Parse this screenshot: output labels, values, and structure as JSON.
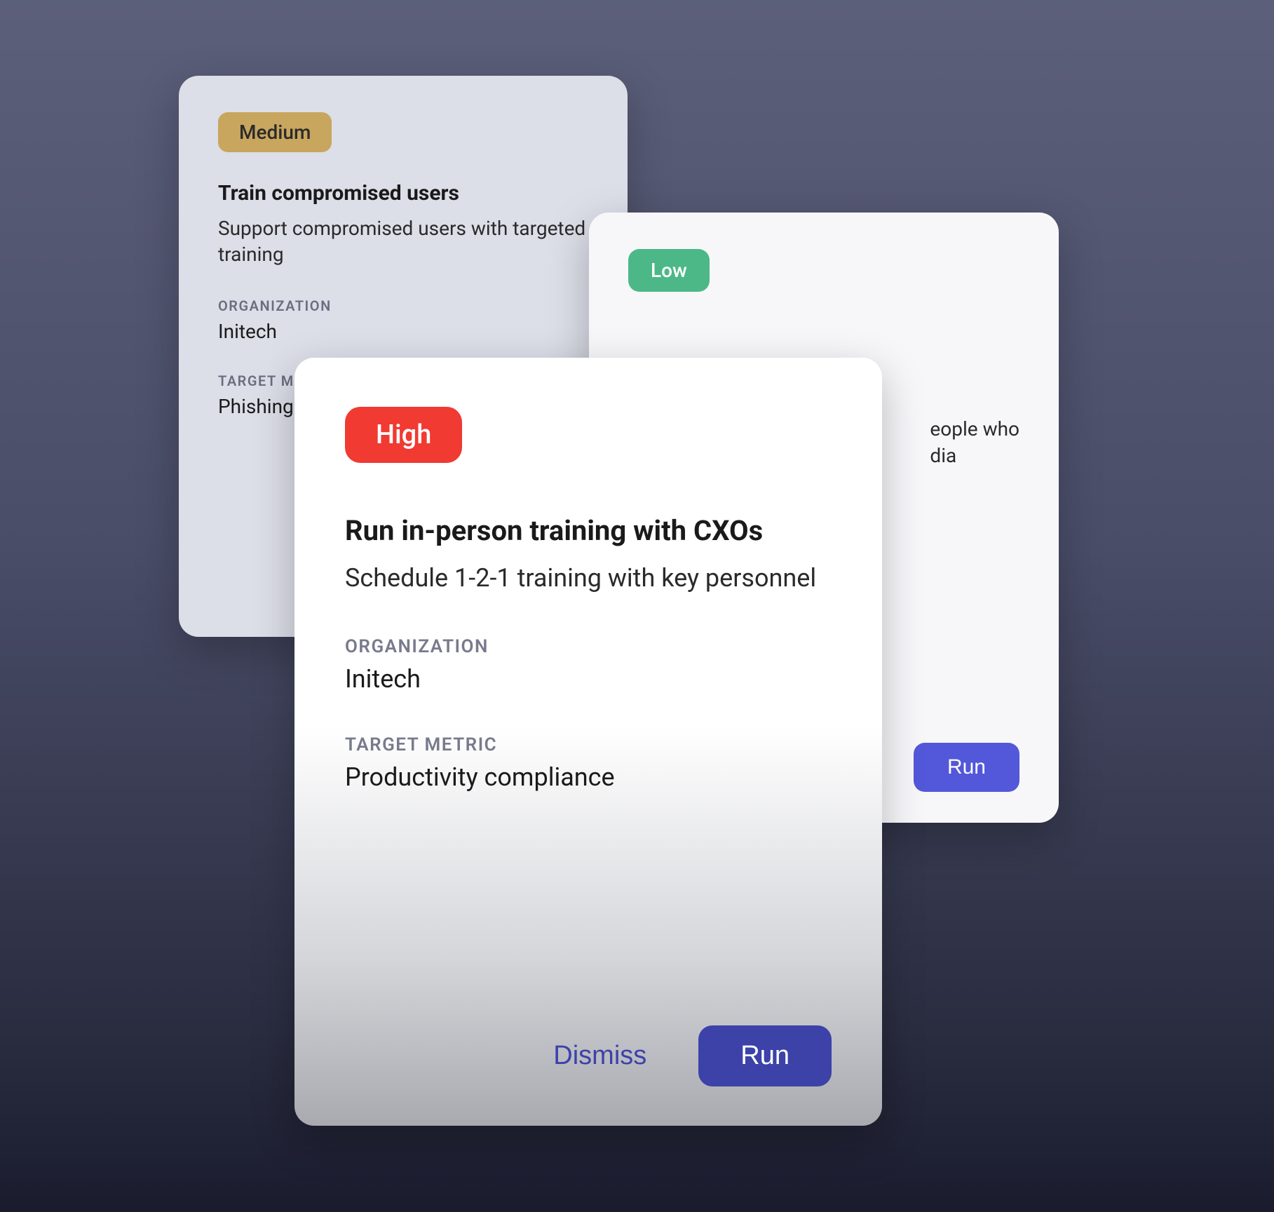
{
  "cards": {
    "medium": {
      "priority": "Medium",
      "title": "Train compromised users",
      "subtitle": "Support compromised users with targeted training",
      "org_label": "ORGANIZATION",
      "org_value": "Initech",
      "metric_label": "TARGET METRIC",
      "metric_value": "Phishing"
    },
    "low": {
      "priority": "Low",
      "peek_line1": "eople who",
      "peek_line2": "dia",
      "run_label": "Run"
    },
    "high": {
      "priority": "High",
      "title": "Run in-person training with CXOs",
      "subtitle": "Schedule 1-2-1 training with key personnel",
      "org_label": "ORGANIZATION",
      "org_value": "Initech",
      "metric_label": "TARGET METRIC",
      "metric_value": "Productivity compliance",
      "dismiss_label": "Dismiss",
      "run_label": "Run"
    }
  },
  "colors": {
    "priority_high": "#f03a32",
    "priority_medium": "#c8a65d",
    "priority_low": "#4cb887",
    "button_primary": "#5258d9"
  }
}
